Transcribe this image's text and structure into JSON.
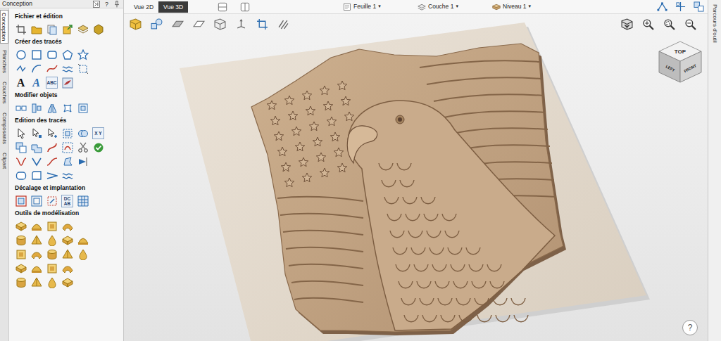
{
  "panel": {
    "title": "Conception",
    "help": "?",
    "side_tabs": [
      {
        "label": "Conception",
        "selected": true
      },
      {
        "label": "Planches",
        "selected": false
      },
      {
        "label": "Couches",
        "selected": false
      },
      {
        "label": "Composants",
        "selected": false
      },
      {
        "label": "Clipart",
        "selected": false
      }
    ],
    "sections": [
      {
        "title": "Fichier et édition",
        "rows": [
          [
            {
              "kind": "icon"
            },
            {
              "kind": "icon"
            },
            {
              "kind": "icon"
            },
            {
              "kind": "icon"
            },
            {
              "kind": "icon"
            },
            {
              "kind": "icon"
            }
          ]
        ]
      },
      {
        "title": "Créer des tracés",
        "rows": [
          [
            {
              "kind": "icon"
            },
            {
              "kind": "icon"
            },
            {
              "kind": "icon"
            },
            {
              "kind": "icon"
            },
            {
              "kind": "icon"
            }
          ],
          [
            {
              "kind": "icon"
            },
            {
              "kind": "icon"
            },
            {
              "kind": "icon"
            },
            {
              "kind": "icon"
            },
            {
              "kind": "icon"
            }
          ],
          [
            {
              "kind": "text",
              "text": "A"
            },
            {
              "kind": "outlined",
              "text": "A"
            },
            {
              "kind": "text",
              "text": "ABC"
            },
            {
              "kind": "icon"
            }
          ]
        ]
      },
      {
        "title": "Modifier objets",
        "rows": [
          [
            {
              "kind": "icon"
            },
            {
              "kind": "icon"
            },
            {
              "kind": "icon"
            },
            {
              "kind": "icon"
            },
            {
              "kind": "icon"
            }
          ]
        ]
      },
      {
        "title": "Edition des tracés",
        "rows": [
          [
            {
              "kind": "icon"
            },
            {
              "kind": "icon"
            },
            {
              "kind": "icon"
            },
            {
              "kind": "icon"
            },
            {
              "kind": "icon"
            },
            {
              "kind": "text",
              "text": "X Y"
            }
          ],
          [
            {
              "kind": "icon"
            },
            {
              "kind": "icon"
            },
            {
              "kind": "icon"
            },
            {
              "kind": "icon"
            },
            {
              "kind": "icon"
            },
            {
              "kind": "icon"
            }
          ],
          [
            {
              "kind": "icon"
            },
            {
              "kind": "icon"
            },
            {
              "kind": "icon"
            },
            {
              "kind": "icon"
            },
            {
              "kind": "icon"
            }
          ],
          [
            {
              "kind": "icon"
            },
            {
              "kind": "icon"
            },
            {
              "kind": "icon"
            },
            {
              "kind": "icon"
            }
          ]
        ]
      },
      {
        "title": "Décalage et implantation",
        "rows": [
          [
            {
              "kind": "icon"
            },
            {
              "kind": "icon"
            },
            {
              "kind": "icon"
            },
            {
              "kind": "text",
              "text": "DC AB"
            },
            {
              "kind": "icon"
            }
          ]
        ]
      },
      {
        "title": "Outils de modélisation",
        "rows": [
          [
            {
              "kind": "icon"
            },
            {
              "kind": "icon"
            },
            {
              "kind": "icon"
            },
            {
              "kind": "icon"
            }
          ],
          [
            {
              "kind": "icon"
            },
            {
              "kind": "icon"
            },
            {
              "kind": "icon"
            },
            {
              "kind": "icon"
            },
            {
              "kind": "icon"
            }
          ],
          [
            {
              "kind": "icon"
            },
            {
              "kind": "icon"
            },
            {
              "kind": "icon"
            },
            {
              "kind": "icon"
            },
            {
              "kind": "icon"
            }
          ],
          [
            {
              "kind": "icon"
            },
            {
              "kind": "icon"
            },
            {
              "kind": "icon"
            },
            {
              "kind": "icon"
            }
          ],
          [
            {
              "kind": "icon"
            },
            {
              "kind": "icon"
            },
            {
              "kind": "icon"
            },
            {
              "kind": "icon"
            }
          ]
        ]
      }
    ]
  },
  "view_tabs": [
    {
      "label": "Vue 2D",
      "selected": false
    },
    {
      "label": "Vue 3D",
      "selected": true
    }
  ],
  "dropdowns": [
    {
      "label": "Feuille 1",
      "caret": "▾"
    },
    {
      "label": "Couche 1",
      "caret": "▾"
    },
    {
      "label": "Niveau 1",
      "caret": "▾"
    }
  ],
  "view_cube": {
    "top": "TOP",
    "left": "LEFT",
    "front": "FRONT"
  },
  "help_button": "?",
  "right_tab": {
    "label": "Parcours d'outil",
    "selected": false
  }
}
